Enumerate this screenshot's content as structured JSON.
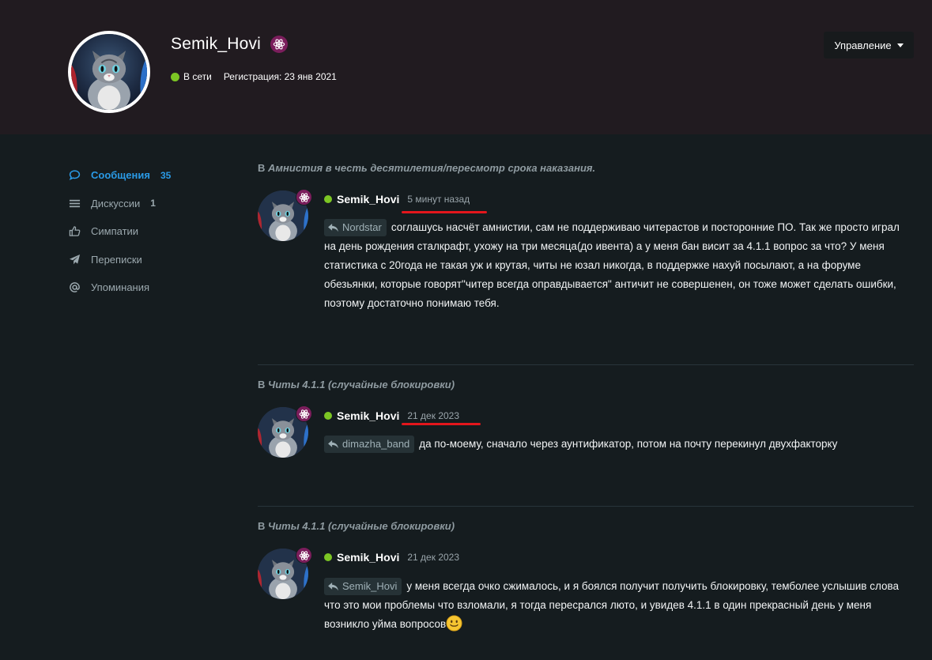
{
  "colors": {
    "accent": "#2a9ae6",
    "online": "#7cc624",
    "badge": "#7b1e5c",
    "header_bg": "#211b20",
    "page_bg": "#151c1f",
    "underline": "#e3161c"
  },
  "profile": {
    "username": "Semik_Hovi",
    "status": "В сети",
    "registration": "Регистрация: 23 янв 2021",
    "badge_icon": "atom-icon",
    "manage_label": "Управление"
  },
  "sidebar": {
    "items": [
      {
        "label": "Сообщения",
        "count": "35",
        "icon": "speech-bubble-icon",
        "active": true
      },
      {
        "label": "Дискуссии",
        "count": "1",
        "icon": "list-icon",
        "active": false
      },
      {
        "label": "Симпатии",
        "count": "",
        "icon": "thumbs-up-icon",
        "active": false
      },
      {
        "label": "Переписки",
        "count": "",
        "icon": "paper-plane-icon",
        "active": false
      },
      {
        "label": "Упоминания",
        "count": "",
        "icon": "at-sign-icon",
        "active": false
      }
    ]
  },
  "posts": [
    {
      "context_prefix": "В",
      "context_title": "Амнистия в честь десятилетия/пересмотр срока наказания.",
      "author": "Semik_Hovi",
      "time": "5 минут назад",
      "reply_to": "Nordstar",
      "text": "соглашусь насчёт амнистии, сам не поддерживаю читерастов и посторонние ПО. Так же просто играл на день рождения сталкрафт, ухожу на три месяца(до ивента) а у меня бан висит за 4.1.1 вопрос за что? У меня статистика с 20года не такая уж и крутая, читы не юзал никогда, в поддержке нахуй посылают, а на форуме обезьянки, которые говорят\"читер всегда оправдывается\" античит не совершенен, он тоже может сделать ошибки, поэтому достаточно понимаю тебя."
    },
    {
      "context_prefix": "В",
      "context_title": "Читы 4.1.1 (случайные блокировки)",
      "author": "Semik_Hovi",
      "time": "21 дек 2023",
      "reply_to": "dimazha_band",
      "text": "да по-моему, сначало через аунтификатор, потом на почту перекинул двухфакторку"
    },
    {
      "context_prefix": "В",
      "context_title": "Читы 4.1.1 (случайные блокировки)",
      "author": "Semik_Hovi",
      "time": "21 дек 2023",
      "reply_to": "Semik_Hovi",
      "text": "у меня всегда очко сжималось, и я боялся получит получить блокировку, темболее услышив слова что это мои проблемы что взломали, я тогда пересрался люто, и увидев 4.1.1 в один прекрасный день у меня возникло уйма вопросов",
      "trailing_icon": "smile-emoji-icon"
    }
  ]
}
